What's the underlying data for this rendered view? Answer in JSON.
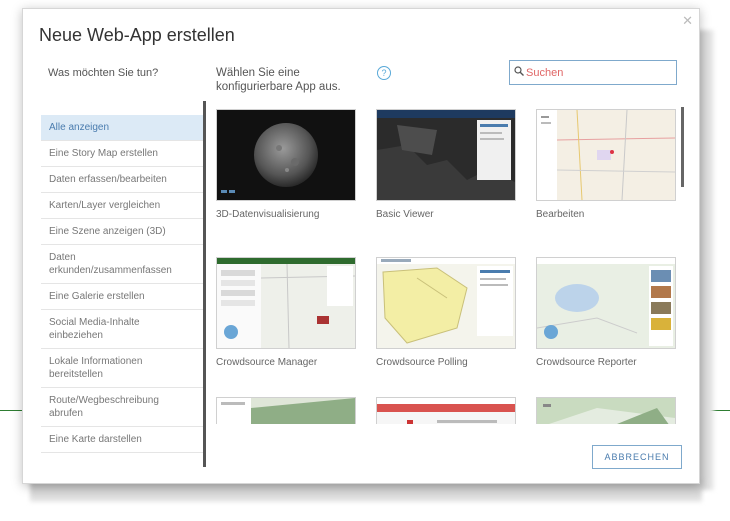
{
  "dialog": {
    "title": "Neue Web-App erstellen",
    "question": "Was möchten Sie tun?",
    "prompt": "Wählen Sie eine konfigurierbare App aus.",
    "help_icon": "?"
  },
  "search": {
    "placeholder": "Suchen",
    "value": ""
  },
  "sidebar": {
    "items": [
      {
        "label": "Alle anzeigen",
        "selected": true
      },
      {
        "label": "Eine Story Map erstellen"
      },
      {
        "label": "Daten erfassen/bearbeiten"
      },
      {
        "label": "Karten/Layer vergleichen"
      },
      {
        "label": "Eine Szene anzeigen (3D)"
      },
      {
        "label": "Daten erkunden/zusammenfassen"
      },
      {
        "label": "Eine Galerie erstellen"
      },
      {
        "label": "Social Media-Inhalte einbeziehen"
      },
      {
        "label": "Lokale Informationen bereitstellen"
      },
      {
        "label": "Route/Wegbeschreibung abrufen"
      },
      {
        "label": "Eine Karte darstellen"
      }
    ]
  },
  "apps": [
    {
      "label": "3D-Datenvisualisierung"
    },
    {
      "label": "Basic Viewer"
    },
    {
      "label": "Bearbeiten"
    },
    {
      "label": "Crowdsource Manager"
    },
    {
      "label": "Crowdsource Polling"
    },
    {
      "label": "Crowdsource Reporter"
    },
    {
      "label": ""
    },
    {
      "label": ""
    },
    {
      "label": ""
    }
  ],
  "footer": {
    "cancel_label": "ABBRECHEN"
  },
  "icons": {
    "close": "close-icon",
    "search": "search-icon",
    "help": "help-icon"
  },
  "colors": {
    "accent": "#4a7cae",
    "selected_bg": "#dceaf6",
    "border": "#7fa9cc"
  }
}
